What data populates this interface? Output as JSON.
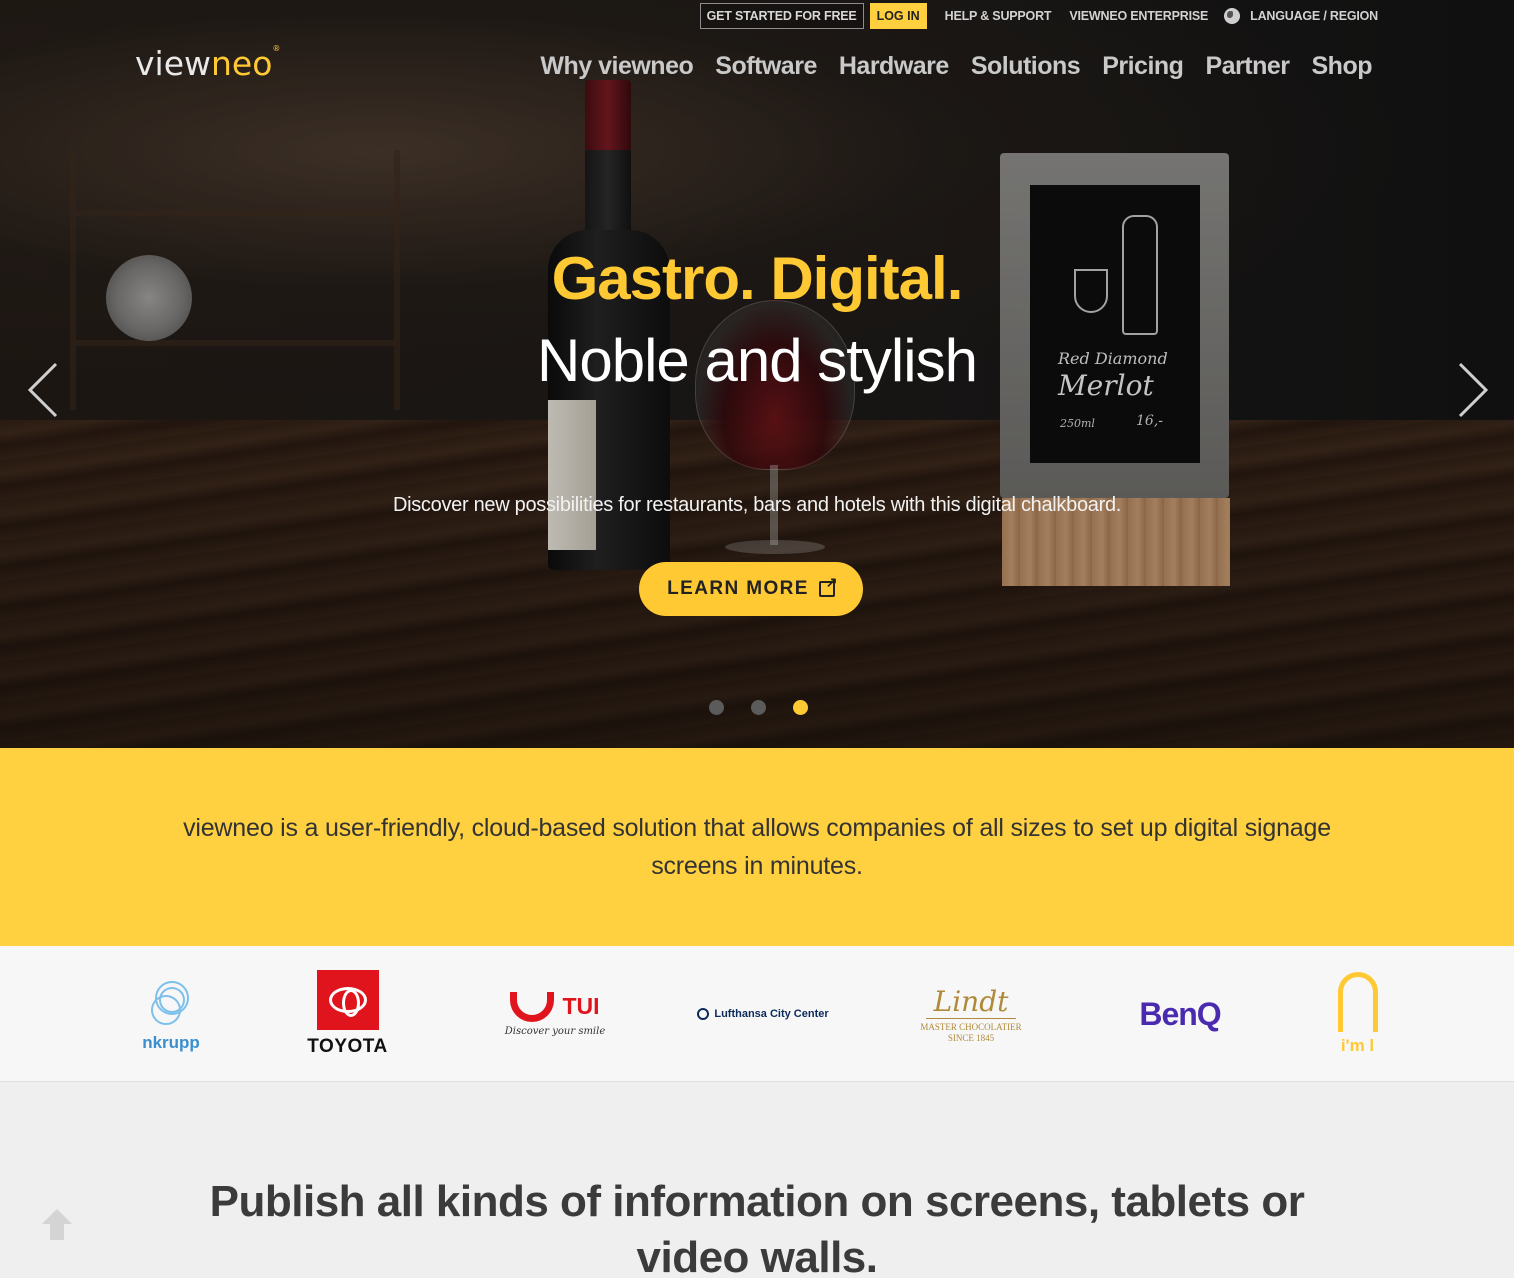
{
  "utility": {
    "get_started": "GET STARTED FOR FREE",
    "login": "LOG IN",
    "help": "HELP & SUPPORT",
    "enterprise": "VIEWNEO ENTERPRISE",
    "language": "LANGUAGE / REGION"
  },
  "logo": {
    "view": "view",
    "neo": "neo",
    "mark": "®"
  },
  "nav": [
    {
      "label": "Why viewneo"
    },
    {
      "label": "Software"
    },
    {
      "label": "Hardware"
    },
    {
      "label": "Solutions"
    },
    {
      "label": "Pricing"
    },
    {
      "label": "Partner"
    },
    {
      "label": "Shop"
    }
  ],
  "hero": {
    "title": "Gastro. Digital.",
    "subtitle": "Noble and stylish",
    "description": "Discover new possibilities for restaurants, bars and hotels with this digital chalkboard.",
    "cta": "LEARN MORE",
    "chalkboard": {
      "line1": "Red Diamond",
      "line2": "Merlot",
      "line3": "250ml",
      "line4": "16,-"
    },
    "slides_total": 3,
    "active_slide": 3
  },
  "band": {
    "text": "viewneo is a user-friendly, cloud-based solution that allows companies of all sizes to set up digital signage screens in minutes."
  },
  "logos": {
    "thyssenkrupp": "nkrupp",
    "toyota": "TOYOTA",
    "tui": "TUI",
    "tui_tagline": "Discover your smile",
    "lufthansa": "Lufthansa City Center",
    "lindt": "Lindt",
    "lindt_sub1": "MASTER CHOCOLATIER",
    "lindt_sub2": "SINCE 1845",
    "benq": "BenQ",
    "mcdonalds": "i'm l"
  },
  "section": {
    "heading": "Publish all kinds of information on screens, tablets or video walls."
  },
  "colors": {
    "accent": "#ffc933",
    "band": "#ffd03f"
  }
}
